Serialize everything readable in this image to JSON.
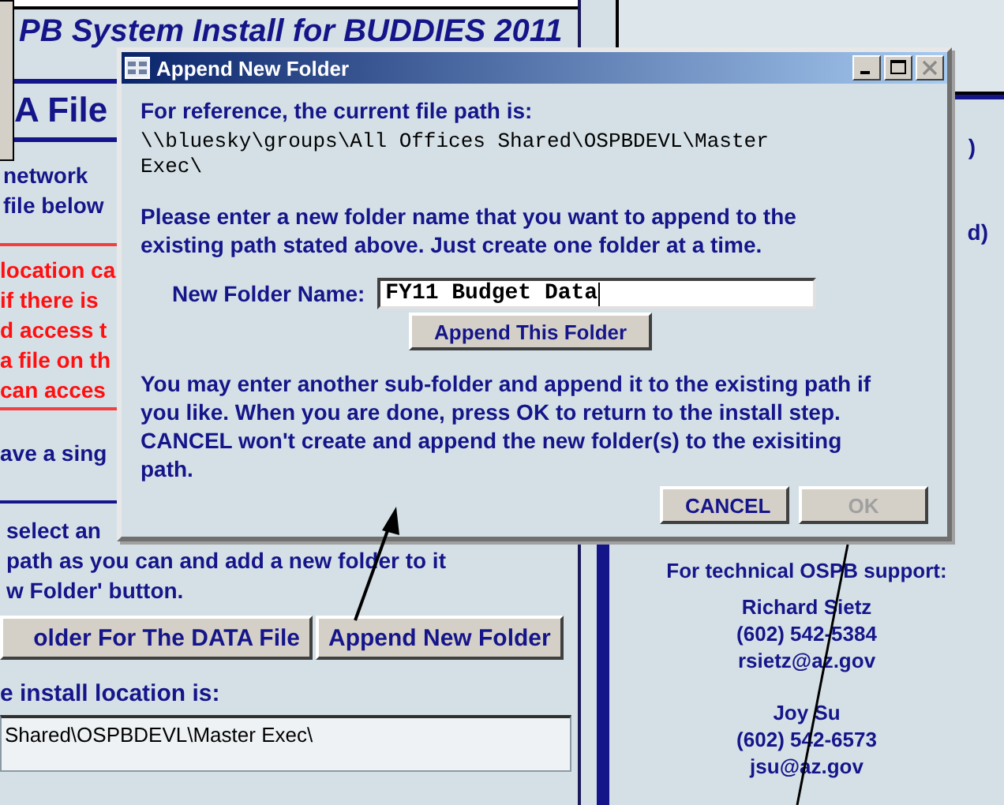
{
  "background_window": {
    "title": "PB System Install for BUDDIES 2011",
    "heading": "A File",
    "intro_lines": [
      "network",
      "file below"
    ],
    "warning_lines": [
      "location ca",
      "if there is",
      "d access t",
      "a file on th",
      "can acces"
    ],
    "note_line": "ave a sing",
    "instruction_lines": [
      "select an",
      "path as you can and add a new folder to it",
      "w Folder' button."
    ],
    "buttons": [
      {
        "label": "older For The DATA File"
      },
      {
        "label": "Append New Folder"
      }
    ],
    "location_label": "e install location is:",
    "location_value": "Shared\\OSPBDEVL\\Master Exec\\",
    "side_fragments": [
      ")",
      "d)"
    ],
    "support": {
      "heading": "For technical OSPB support:",
      "contacts": [
        {
          "name": "Richard Sietz",
          "phone": "(602) 542-5384",
          "email": "rsietz@az.gov"
        },
        {
          "name": "Joy Su",
          "phone": "(602) 542-6573",
          "email": "jsu@az.gov"
        }
      ]
    }
  },
  "dialog": {
    "title": "Append New Folder",
    "close_disabled": true,
    "reference_label": "For reference, the current file path is:",
    "current_path": "\\\\bluesky\\groups\\All Offices Shared\\OSPBDEVL\\Master Exec\\",
    "instructions": "Please enter a new folder name that you want to append to the existing path stated above. Just create one folder at a time.",
    "folder_label": "New Folder Name:",
    "folder_value": "FY11 Budget Data",
    "append_button": "Append This Folder",
    "note": "You may enter another sub-folder and append it to the existing path if you like. When you are done, press OK to return to the install step. CANCEL won't create and append the new folder(s) to the exisiting path.",
    "buttons": [
      {
        "label": "CANCEL",
        "disabled": false
      },
      {
        "label": "OK",
        "disabled": true
      }
    ]
  }
}
